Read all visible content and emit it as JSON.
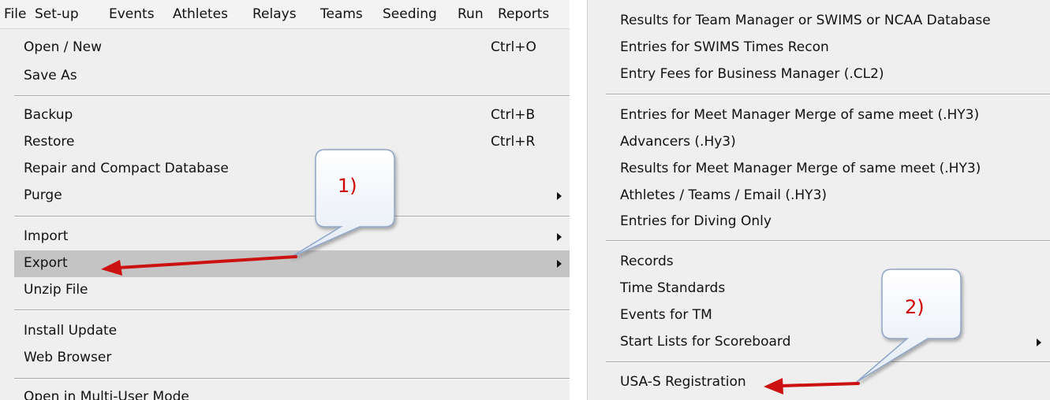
{
  "menubar": {
    "items": [
      "File",
      "Set-up",
      "Events",
      "Athletes",
      "Relays",
      "Teams",
      "Seeding",
      "Run",
      "Reports"
    ]
  },
  "file_menu": {
    "open_new": {
      "label": "Open / New",
      "shortcut": "Ctrl+O"
    },
    "save_as": {
      "label": "Save As"
    },
    "backup": {
      "label": "Backup",
      "shortcut": "Ctrl+B"
    },
    "restore": {
      "label": "Restore",
      "shortcut": "Ctrl+R"
    },
    "repair": {
      "label": "Repair and Compact Database"
    },
    "purge": {
      "label": "Purge"
    },
    "import": {
      "label": "Import"
    },
    "export": {
      "label": "Export"
    },
    "unzip": {
      "label": "Unzip File"
    },
    "install_update": {
      "label": "Install Update"
    },
    "web_browser": {
      "label": "Web Browser"
    },
    "multi_user": {
      "label": "Open in Multi-User Mode"
    }
  },
  "export_menu": {
    "results_tm": "Results for Team Manager or SWIMS or NCAA Database",
    "entries_swims": "Entries for SWIMS Times Recon",
    "entry_fees": "Entry Fees for Business Manager  (.CL2)",
    "entries_merge": "Entries for Meet Manager Merge of same meet  (.HY3)",
    "advancers": "Advancers  (.Hy3)",
    "results_merge": "Results for Meet Manager Merge of same meet  (.HY3)",
    "athletes_teams": "Athletes / Teams / Email  (.HY3)",
    "entries_diving": "Entries for Diving Only",
    "records": "Records",
    "time_standards": "Time Standards",
    "events_tm": "Events for TM",
    "start_lists": "Start Lists for Scoreboard",
    "usa_s": "USA-S Registration"
  },
  "callouts": {
    "one": "1)",
    "two": "2)"
  },
  "colors": {
    "arrow": "#cc1111",
    "callout_text": "#d00000",
    "highlight": "#c4c4c4",
    "menu_bg": "#efefef"
  }
}
